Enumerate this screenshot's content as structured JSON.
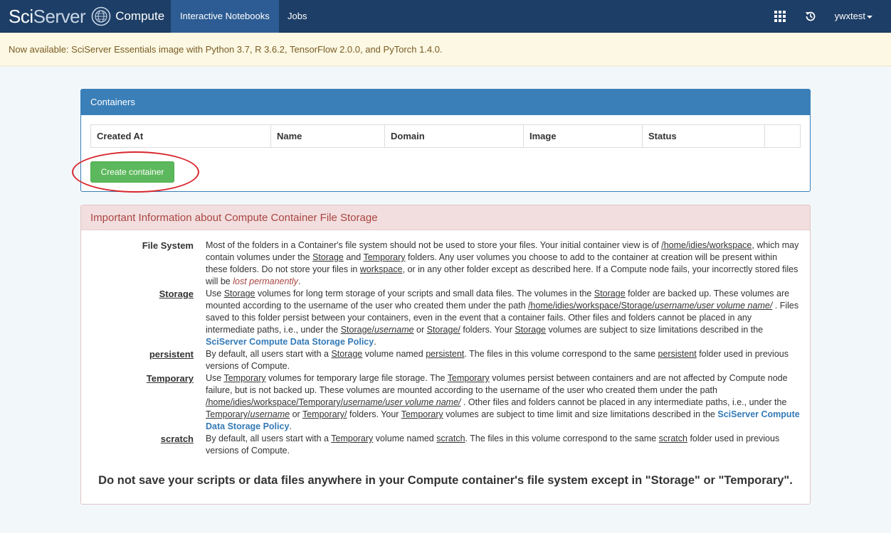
{
  "navbar": {
    "brand_sci": "SciServer",
    "brand_sci_part1": "Sci",
    "brand_sci_part2": "Server",
    "brand_compute": "Compute",
    "tabs": [
      {
        "label": "Interactive Notebooks",
        "active": true
      },
      {
        "label": "Jobs",
        "active": false
      }
    ],
    "apps_icon": "grid-icon",
    "history_icon": "history-icon",
    "user": "ywxtest",
    "colors": {
      "bar": "#1d3e66",
      "active_tab": "#2c5c93"
    }
  },
  "announcement": "Now available: SciServer Essentials image with Python 3.7, R 3.6.2, TensorFlow 2.0.0, and PyTorch 1.4.0.",
  "containers": {
    "title": "Containers",
    "columns": [
      "Created At",
      "Name",
      "Domain",
      "Image",
      "Status",
      ""
    ],
    "create_button": "Create container"
  },
  "info": {
    "title": "Important Information about Compute Container File Storage",
    "fs": {
      "term": "File System",
      "t1": "Most of the folders in a Container's file system should not be used to store your files. Your initial container view is of ",
      "path": "/home/idies/workspace",
      "t2": ", which may contain volumes under the ",
      "storage": "Storage",
      "t3": " and ",
      "temporary": "Temporary",
      "t4": " folders. Any user volumes you choose to add to the container at creation will be present within these folders. Do not store your files in ",
      "workspace": "workspace",
      "t5": ", or in any other folder except as described here. If a Compute node fails, your incorrectly stored files will be ",
      "lost": "lost permanently",
      "t6": "."
    },
    "storage": {
      "term": "Storage",
      "t1": "Use ",
      "w1": "Storage",
      "t2": " volumes for long term storage of your scripts and small data files. The volumes in the ",
      "w2": "Storage",
      "t3": " folder are backed up. These volumes are mounted according to the username of the user who created them under the path ",
      "p1": "/home/idies/workspace/Storage/",
      "p2": "username/user volume name/",
      "t4": " . Files saved to this folder persist between your containers, even in the event that a container fails. Other files and folders cannot be placed in any intermediate paths, i.e., under the ",
      "p3": "Storage/",
      "p4": "username",
      "t5": " or ",
      "p5": "Storage/",
      "t6": " folders. Your ",
      "w3": "Storage",
      "t7": " volumes are subject to size limitations described in the ",
      "policy": "SciServer Compute Data Storage Policy",
      "t8": "."
    },
    "persistent": {
      "term": "persistent",
      "t1": "By default, all users start with a ",
      "w1": "Storage",
      "t2": " volume named ",
      "w2": "persistent",
      "t3": ". The files in this volume correspond to the same ",
      "w3": "persistent",
      "t4": " folder used in previous versions of Compute."
    },
    "temporary": {
      "term": "Temporary",
      "t1": "Use ",
      "w1": "Temporary",
      "t2": " volumes for temporary large file storage. The ",
      "w2": "Temporary",
      "t3": " volumes persist between containers and are not affected by Compute node failure, but is not backed up. These volumes are mounted according to the username of the user who created them under the path ",
      "p1": "/home/idies/workspace/Temporary/",
      "p2": "username/user volume name/",
      "t4": " . Other files and folders cannot be placed in any intermediate paths, i.e., under the ",
      "p3": "Temporary/",
      "p4": "username",
      "t5": " or ",
      "p5": "Temporary/",
      "t6": " folders. Your ",
      "w3": "Temporary",
      "t7": " volumes are subject to time limit and size limitations described in the ",
      "policy": "SciServer Compute Data Storage Policy",
      "t8": "."
    },
    "scratch": {
      "term": "scratch",
      "t1": "By default, all users start with a ",
      "w1": "Temporary",
      "t2": " volume named ",
      "w2": "scratch",
      "t3": ". The files in this volume correspond to the same ",
      "w3": "scratch",
      "t4": " folder used in previous versions of Compute."
    },
    "warning": "Do not save your scripts or data files anywhere in your Compute container's file system except in \"Storage\" or \"Temporary\"."
  },
  "colors": {
    "success": "#5cb85c",
    "primary": "#3a7fb8",
    "danger_text": "#a94442",
    "danger_bg": "#f2dede",
    "warning_bg": "#fcf8e3",
    "annotation": "#d9262b"
  }
}
